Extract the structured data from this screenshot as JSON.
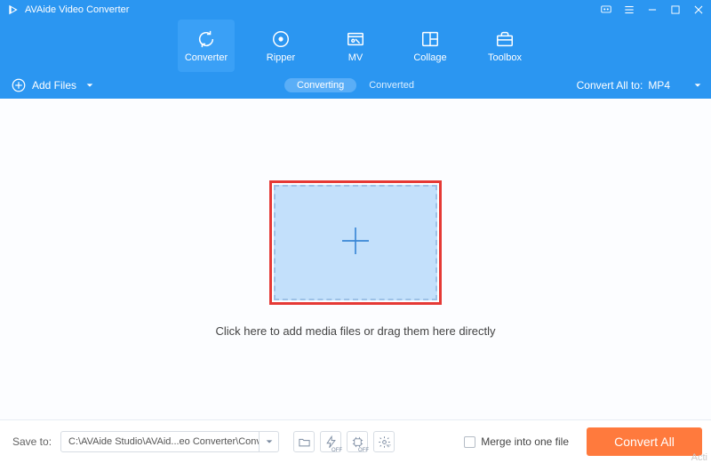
{
  "app": {
    "title": "AVAide Video Converter"
  },
  "nav": {
    "items": [
      {
        "label": "Converter"
      },
      {
        "label": "Ripper"
      },
      {
        "label": "MV"
      },
      {
        "label": "Collage"
      },
      {
        "label": "Toolbox"
      }
    ]
  },
  "toolbar": {
    "add_files_label": "Add Files",
    "tab_converting": "Converting",
    "tab_converted": "Converted",
    "convert_all_to_label": "Convert All to:",
    "selected_format": "MP4"
  },
  "workspace": {
    "drop_text": "Click here to add media files or drag them here directly"
  },
  "bottom": {
    "save_to_label": "Save to:",
    "save_path": "C:\\AVAide Studio\\AVAid...eo Converter\\Converted",
    "merge_label": "Merge into one file",
    "convert_button": "Convert All",
    "hw_badge": "OFF"
  },
  "watermark": "Acti"
}
